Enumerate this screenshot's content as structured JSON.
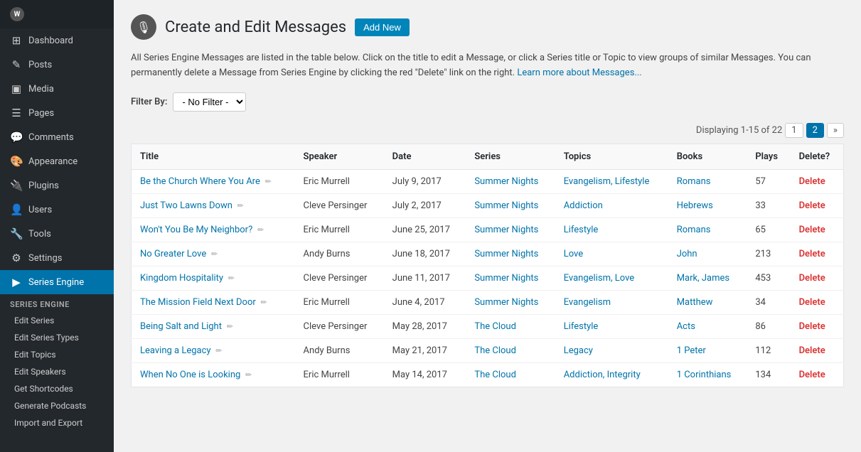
{
  "sidebar": {
    "logo_text": "W",
    "items": [
      {
        "label": "Dashboard",
        "icon": "⊞",
        "name": "dashboard"
      },
      {
        "label": "Posts",
        "icon": "📝",
        "name": "posts"
      },
      {
        "label": "Media",
        "icon": "🖼",
        "name": "media"
      },
      {
        "label": "Pages",
        "icon": "📄",
        "name": "pages"
      },
      {
        "label": "Comments",
        "icon": "💬",
        "name": "comments"
      },
      {
        "label": "Appearance",
        "icon": "🎨",
        "name": "appearance"
      },
      {
        "label": "Plugins",
        "icon": "🔌",
        "name": "plugins"
      },
      {
        "label": "Users",
        "icon": "👤",
        "name": "users"
      },
      {
        "label": "Tools",
        "icon": "🔧",
        "name": "tools"
      },
      {
        "label": "Settings",
        "icon": "⚙",
        "name": "settings"
      },
      {
        "label": "Series Engine",
        "icon": "▶",
        "name": "series-engine",
        "active": true
      }
    ],
    "sub_section_label": "Series Engine",
    "sub_items": [
      {
        "label": "Edit Series",
        "name": "edit-series"
      },
      {
        "label": "Edit Series Types",
        "name": "edit-series-types"
      },
      {
        "label": "Edit Topics",
        "name": "edit-topics"
      },
      {
        "label": "Edit Speakers",
        "name": "edit-speakers"
      },
      {
        "label": "Get Shortcodes",
        "name": "get-shortcodes"
      },
      {
        "label": "Generate Podcasts",
        "name": "generate-podcasts"
      },
      {
        "label": "Import and Export",
        "name": "import-export"
      }
    ]
  },
  "page": {
    "title": "Create and Edit Messages",
    "add_new_label": "Add New",
    "description": "All Series Engine Messages are listed in the table below. Click on the title to edit a Message, or click a Series title or Topic to view groups of similar Messages. You can permanently delete a Message from Series Engine by clicking the red \"Delete\" link on the right.",
    "learn_more_link": "Learn more about Messages...",
    "filter_label": "Filter By:",
    "filter_default": "- No Filter -",
    "pagination_info": "Displaying 1-15 of 22",
    "pagination_pages": [
      "1",
      "2",
      "»"
    ]
  },
  "table": {
    "headers": [
      "Title",
      "Speaker",
      "Date",
      "Series",
      "Topics",
      "Books",
      "Plays",
      "Delete?"
    ],
    "rows": [
      {
        "title": "Be the Church Where You Are",
        "speaker": "Eric Murrell",
        "date": "July 9, 2017",
        "series": "Summer Nights",
        "topics": "Evangelism, Lifestyle",
        "books": "Romans",
        "plays": "57",
        "delete": "Delete"
      },
      {
        "title": "Just Two Lawns Down",
        "speaker": "Cleve Persinger",
        "date": "July 2, 2017",
        "series": "Summer Nights",
        "topics": "Addiction",
        "books": "Hebrews",
        "plays": "33",
        "delete": "Delete"
      },
      {
        "title": "Won't You Be My Neighbor?",
        "speaker": "Eric Murrell",
        "date": "June 25, 2017",
        "series": "Summer Nights",
        "topics": "Lifestyle",
        "books": "Romans",
        "plays": "65",
        "delete": "Delete"
      },
      {
        "title": "No Greater Love",
        "speaker": "Andy Burns",
        "date": "June 18, 2017",
        "series": "Summer Nights",
        "topics": "Love",
        "books": "John",
        "plays": "213",
        "delete": "Delete"
      },
      {
        "title": "Kingdom Hospitality",
        "speaker": "Cleve Persinger",
        "date": "June 11, 2017",
        "series": "Summer Nights",
        "topics": "Evangelism, Love",
        "books": "Mark, James",
        "plays": "453",
        "delete": "Delete"
      },
      {
        "title": "The Mission Field Next Door",
        "speaker": "Eric Murrell",
        "date": "June 4, 2017",
        "series": "Summer Nights",
        "topics": "Evangelism",
        "books": "Matthew",
        "plays": "34",
        "delete": "Delete"
      },
      {
        "title": "Being Salt and Light",
        "speaker": "Cleve Persinger",
        "date": "May 28, 2017",
        "series": "The Cloud",
        "topics": "Lifestyle",
        "books": "Acts",
        "plays": "86",
        "delete": "Delete"
      },
      {
        "title": "Leaving a Legacy",
        "speaker": "Andy Burns",
        "date": "May 21, 2017",
        "series": "The Cloud",
        "topics": "Legacy",
        "books": "1 Peter",
        "plays": "112",
        "delete": "Delete"
      },
      {
        "title": "When No One is Looking",
        "speaker": "Eric Murrell",
        "date": "May 14, 2017",
        "series": "The Cloud",
        "topics": "Addiction, Integrity",
        "books": "1 Corinthians",
        "plays": "134",
        "delete": "Delete"
      }
    ]
  }
}
